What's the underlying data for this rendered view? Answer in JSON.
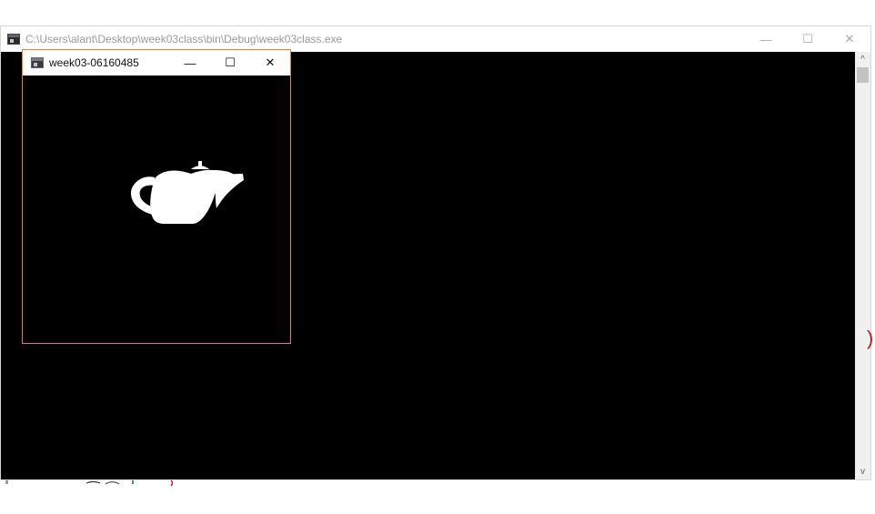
{
  "console_window": {
    "title": "C:\\Users\\alant\\Desktop\\week03class\\bin\\Debug\\week03class.exe",
    "controls": {
      "minimize": "—",
      "maximize": "☐",
      "close": "✕"
    },
    "scrollbar": {
      "up": "^",
      "down": "v"
    }
  },
  "glut_window": {
    "title": "week03-06160485",
    "controls": {
      "minimize": "—",
      "maximize": "☐",
      "close": "✕"
    },
    "object_icon": "teapot-icon",
    "object_color": "#ffffff",
    "frame_color": "#e87f3e"
  },
  "side_mark": ")"
}
